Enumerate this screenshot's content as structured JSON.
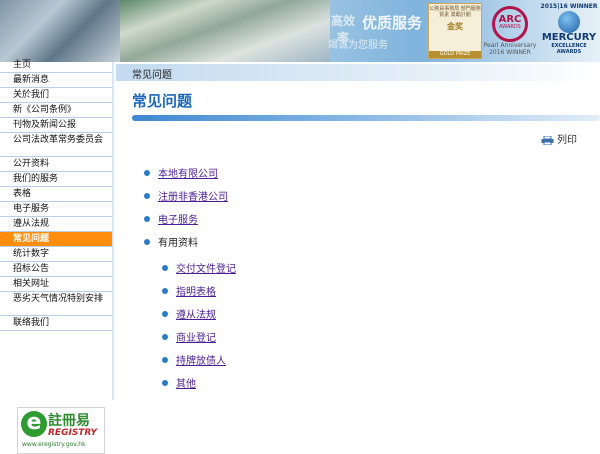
{
  "banner": {
    "slogan_line1": "高效率",
    "slogan_line2": "优质服务",
    "slogan_line3": "竭诚为您服务",
    "award1": {
      "top": "公務員事務局 部門服務質素 獎勵計劃",
      "medal": "金奖",
      "bottom": "GOLD PRIZE"
    },
    "award2": {
      "name": "ARC",
      "sub": "AWARDS",
      "line1": "Pearl Anniversary",
      "line2": "2016 WINNER"
    },
    "award3": {
      "line1": "2015|16 WINNER",
      "name": "MERCURY",
      "line2": "EXCELLENCE AWARDS"
    }
  },
  "sidebar": {
    "items": [
      {
        "label": "主页"
      },
      {
        "label": "最新消息"
      },
      {
        "label": "关於我们"
      },
      {
        "label": "新《公司条例》"
      },
      {
        "label": "刊物及新闻公报"
      },
      {
        "label": "公司法改革常务委员会"
      },
      {
        "label": "公开资料"
      },
      {
        "label": "我们的服务"
      },
      {
        "label": "表格"
      },
      {
        "label": "电子服务"
      },
      {
        "label": "遵从法规"
      },
      {
        "label": "常见问题"
      },
      {
        "label": "统计数字"
      },
      {
        "label": "招标公告"
      },
      {
        "label": "相关网址"
      },
      {
        "label": "恶劣天气情况特别安排"
      },
      {
        "label": "联络我们"
      }
    ],
    "active_index": 11,
    "eregistry": {
      "cn": "註冊易",
      "en": "REGISTRY",
      "url": "www.eregistry.gov.hk"
    }
  },
  "main": {
    "breadcrumb": "常见问题",
    "title": "常见问题",
    "print_label": "列印",
    "faq": [
      {
        "label": "本地有限公司",
        "level": 1,
        "link": true
      },
      {
        "label": "注册非香港公司",
        "level": 1,
        "link": true
      },
      {
        "label": "电子服务",
        "level": 1,
        "link": true
      },
      {
        "label": "有用资料",
        "level": 1,
        "link": false
      },
      {
        "label": "交付文件登记",
        "level": 2,
        "link": true
      },
      {
        "label": "指明表格",
        "level": 2,
        "link": true
      },
      {
        "label": "遵从法规",
        "level": 2,
        "link": true
      },
      {
        "label": "商业登记",
        "level": 2,
        "link": true
      },
      {
        "label": "持牌放债人",
        "level": 2,
        "link": true
      },
      {
        "label": "其他",
        "level": 2,
        "link": true
      }
    ]
  },
  "colors": {
    "accent": "#1b68b8",
    "active_nav": "#ff8d0d",
    "link": "#4b1f93",
    "bullet": "#2a7cc7"
  }
}
